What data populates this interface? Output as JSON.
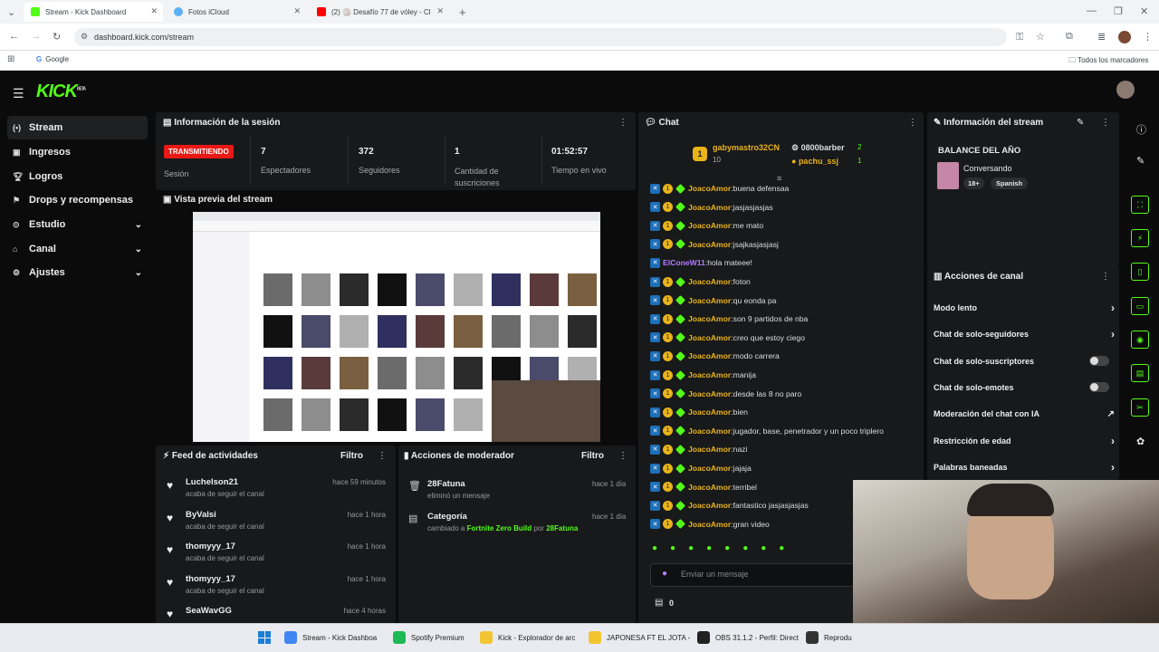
{
  "browser": {
    "tabs": [
      {
        "label": "Stream - Kick Dashboard",
        "color": "#53fc18"
      },
      {
        "label": "Fotos iCloud",
        "color": "#5ab0f0"
      },
      {
        "label": "(2) 🏐 Desafío 77 de vóley - Cl",
        "color": "#ff0000"
      }
    ],
    "url": "dashboard.kick.com/stream",
    "bookmark": "Google",
    "bookmarks_all": "Todos los marcadores"
  },
  "app": {
    "logo": "KICK",
    "logo_beta": "BETA"
  },
  "sidebar": {
    "items": [
      {
        "label": "Stream",
        "icon": "stream-icon"
      },
      {
        "label": "Ingresos",
        "icon": "money-icon"
      },
      {
        "label": "Logros",
        "icon": "trophy-icon"
      },
      {
        "label": "Drops y recompensas",
        "icon": "gift-icon"
      },
      {
        "label": "Estudio",
        "icon": "studio-icon"
      },
      {
        "label": "Canal",
        "icon": "channel-icon"
      },
      {
        "label": "Ajustes",
        "icon": "settings-icon"
      }
    ]
  },
  "session": {
    "title": "Información de la sesión",
    "live_badge": "TRANSMITIENDO",
    "session_label": "Sesión",
    "stats": [
      {
        "value": "7",
        "label": "Espectadores"
      },
      {
        "value": "372",
        "label": "Seguidores"
      },
      {
        "value": "1",
        "label": "Cantidad de suscriciones"
      },
      {
        "value": "01:52:57",
        "label": "Tiempo en vivo"
      }
    ]
  },
  "preview": {
    "title": "Vista previa del stream"
  },
  "feed": {
    "title": "Feed de actividades",
    "filter": "Filtro",
    "items": [
      {
        "name": "Luchelson21",
        "sub": "acaba de seguir el canal",
        "time": "hace 59 minutos"
      },
      {
        "name": "ByValsi",
        "sub": "acaba de seguir el canal",
        "time": "hace 1 hora"
      },
      {
        "name": "thomyyy_17",
        "sub": "acaba de seguir el canal",
        "time": "hace 1 hora"
      },
      {
        "name": "thomyyy_17",
        "sub": "acaba de seguir el canal",
        "time": "hace 1 hora"
      },
      {
        "name": "SeaWavGG",
        "sub": "",
        "time": "hace 4 horas"
      }
    ]
  },
  "mod": {
    "title": "Acciones de moderador",
    "filter": "Filtro",
    "items": [
      {
        "name": "28Fatuna",
        "sub": "eliminó un mensaje",
        "time": "hace 1 día"
      },
      {
        "name": "Categoría",
        "sub_prefix": "cambiado a",
        "sub_game": "Fortnite Zero Build",
        "sub_by": "por",
        "sub_user": "28Fatuna",
        "time": "hace 1 día"
      }
    ]
  },
  "chat": {
    "title": "Chat",
    "top": [
      {
        "name": "gabymastro32CN",
        "count": "10"
      },
      {
        "name": "0800barber",
        "count": "2"
      },
      {
        "name": "pachu_ssj",
        "count": "1"
      }
    ],
    "messages": [
      {
        "user": "JoacoAmor",
        "text": "buena defensaa"
      },
      {
        "user": "JoacoAmor",
        "text": "jasjasjasjas"
      },
      {
        "user": "JoacoAmor",
        "text": "me mato"
      },
      {
        "user": "JoacoAmor",
        "text": "jsajkasjasjasj"
      },
      {
        "user": "ElConeW11",
        "text": "hola mateee!"
      },
      {
        "user": "JoacoAmor",
        "text": "foton"
      },
      {
        "user": "JoacoAmor",
        "text": "qu eonda pa"
      },
      {
        "user": "JoacoAmor",
        "text": "son 9 partidos de nba"
      },
      {
        "user": "JoacoAmor",
        "text": "creo que estoy ciego"
      },
      {
        "user": "JoacoAmor",
        "text": "modo carrera"
      },
      {
        "user": "JoacoAmor",
        "text": "manija"
      },
      {
        "user": "JoacoAmor",
        "text": "desde las 8 no paro"
      },
      {
        "user": "JoacoAmor",
        "text": "bien"
      },
      {
        "user": "JoacoAmor",
        "text": "jugador, base, penetrador y un poco triplero"
      },
      {
        "user": "JoacoAmor",
        "text": "nazi"
      },
      {
        "user": "JoacoAmor",
        "text": "jajaja"
      },
      {
        "user": "JoacoAmor",
        "text": "terribel"
      },
      {
        "user": "JoacoAmor",
        "text": "fantastico jasjasjasjas"
      },
      {
        "user": "JoacoAmor",
        "text": "gran video"
      }
    ],
    "input_placeholder": "Enviar un mensaje",
    "points": "0",
    "colors": {
      "user": "#e8b41a",
      "alt_user": "#b57cff"
    }
  },
  "stream_info": {
    "title": "Información del stream",
    "stream_title": "BALANCE DEL AÑO",
    "category": "Conversando",
    "age_tag": "18+",
    "lang_tag": "Spanish"
  },
  "actions": {
    "title": "Acciones de canal",
    "items": [
      {
        "label": "Modo lento",
        "control": "arrow"
      },
      {
        "label": "Chat de solo-seguidores",
        "control": "arrow"
      },
      {
        "label": "Chat de solo-suscriptores",
        "control": "toggle"
      },
      {
        "label": "Chat de solo-emotes",
        "control": "toggle"
      },
      {
        "label": "Moderación del chat con IA",
        "control": "external"
      },
      {
        "label": "Restricción de edad",
        "control": "arrow"
      },
      {
        "label": "Palabras baneadas",
        "control": "arrow"
      }
    ]
  },
  "taskbar": {
    "items": [
      {
        "label": "Stream - Kick Dashboa",
        "color": "#4285f4"
      },
      {
        "label": "Spotify Premium",
        "color": "#1db954"
      },
      {
        "label": "Kick - Explorador de arc",
        "color": "#f4c430"
      },
      {
        "label": "JAPONESA FT EL JOTA -",
        "color": "#f4c430"
      },
      {
        "label": "OBS 31.1.2 - Perfil: Direct",
        "color": "#222222"
      },
      {
        "label": "Reprodu",
        "color": "#333333"
      }
    ]
  },
  "accent": "#53fc18"
}
